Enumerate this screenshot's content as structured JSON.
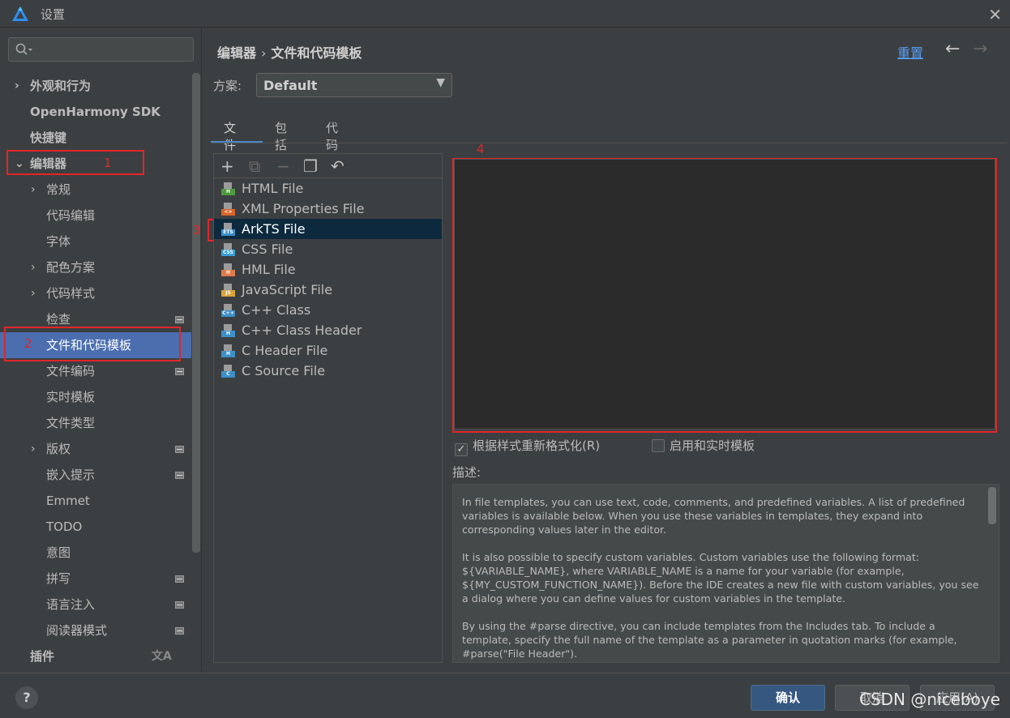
{
  "window": {
    "title": "设置",
    "close": "✕"
  },
  "sidebar": {
    "items": [
      {
        "label": "外观和行为",
        "arrow": "›",
        "bold": true,
        "indent": 0
      },
      {
        "label": "OpenHarmony SDK",
        "bold": true,
        "indent": 0
      },
      {
        "label": "快捷键",
        "bold": true,
        "indent": 0
      },
      {
        "label": "编辑器",
        "arrow": "⌄",
        "bold": true,
        "indent": 0
      },
      {
        "label": "常规",
        "arrow": "›",
        "indent": 1
      },
      {
        "label": "代码编辑",
        "indent": 1
      },
      {
        "label": "字体",
        "indent": 1
      },
      {
        "label": "配色方案",
        "arrow": "›",
        "indent": 1
      },
      {
        "label": "代码样式",
        "arrow": "›",
        "indent": 1
      },
      {
        "label": "检查",
        "indent": 1,
        "mark": true
      },
      {
        "label": "文件和代码模板",
        "indent": 1,
        "selected": true
      },
      {
        "label": "文件编码",
        "indent": 1,
        "mark": true
      },
      {
        "label": "实时模板",
        "indent": 1
      },
      {
        "label": "文件类型",
        "indent": 1
      },
      {
        "label": "版权",
        "arrow": "›",
        "indent": 1,
        "mark": true
      },
      {
        "label": "嵌入提示",
        "indent": 1,
        "mark": true
      },
      {
        "label": "Emmet",
        "indent": 1
      },
      {
        "label": "TODO",
        "indent": 1
      },
      {
        "label": "意图",
        "indent": 1
      },
      {
        "label": "拼写",
        "indent": 1,
        "mark": true
      },
      {
        "label": "语言注入",
        "indent": 1,
        "mark": true
      },
      {
        "label": "阅读器模式",
        "indent": 1,
        "mark": true
      },
      {
        "label": "插件",
        "bold": true,
        "indent": 0,
        "trans": "文A"
      }
    ]
  },
  "annotations": {
    "n1": "1",
    "n2": "2",
    "n3": "3",
    "n4": "4"
  },
  "breadcrumb": {
    "parent": "编辑器",
    "sep": "›",
    "current": "文件和代码模板"
  },
  "header": {
    "reset": "重置",
    "back": "←",
    "forward": "→"
  },
  "scheme": {
    "label": "方案:",
    "value": "Default",
    "caret": "▼"
  },
  "tabs": [
    "文件",
    "包括",
    "代码"
  ],
  "toolbar": {
    "add": "+",
    "copy": "⧉",
    "remove": "−",
    "duplicate": "❐",
    "revert": "↶"
  },
  "files": [
    {
      "name": "HTML File",
      "tag": "H",
      "color": "#4e9a3e"
    },
    {
      "name": "XML Properties File",
      "tag": "<>",
      "color": "#d9652b"
    },
    {
      "name": "ArkTS File",
      "tag": "ETS",
      "color": "#3d8fc8",
      "selected": true
    },
    {
      "name": "CSS File",
      "tag": "CSS",
      "color": "#3aa0d6"
    },
    {
      "name": "HML File",
      "tag": "H",
      "color": "#e17c4a"
    },
    {
      "name": "JavaScript File",
      "tag": "JS",
      "color": "#d9a43a"
    },
    {
      "name": "C++ Class",
      "tag": "C++",
      "color": "#3d8fc8"
    },
    {
      "name": "C++ Class Header",
      "tag": "H",
      "color": "#3d8fc8"
    },
    {
      "name": "C Header File",
      "tag": "H",
      "color": "#3d8fc8"
    },
    {
      "name": "C Source File",
      "tag": "C",
      "color": "#3d8fc8"
    }
  ],
  "options": {
    "reformat": "根据样式重新格式化(R)",
    "reformat_checked": true,
    "live": "启用和实时模板",
    "live_checked": false
  },
  "description": {
    "label": "描述:",
    "p1": "In file templates, you can use text, code, comments, and predefined variables. A list of predefined variables is available below. When you use these variables in templates, they expand into corresponding values later in the editor.",
    "p2": "It is also possible to specify custom variables. Custom variables use the following format: ${VARIABLE_NAME}, where VARIABLE_NAME is a name for your variable (for example, ${MY_CUSTOM_FUNCTION_NAME}). Before the IDE creates a new file with custom variables, you see a dialog where you can define values for custom variables in the template.",
    "p3": "By using the #parse directive, you can include templates from the Includes tab. To include a template, specify the full name of the template as a parameter in quotation marks (for example, #parse(\"File Header\")."
  },
  "footer": {
    "help": "?",
    "ok": "确认",
    "cancel": "取消",
    "apply": "应用(A)",
    "watermark": "CSDN @niceboye"
  }
}
